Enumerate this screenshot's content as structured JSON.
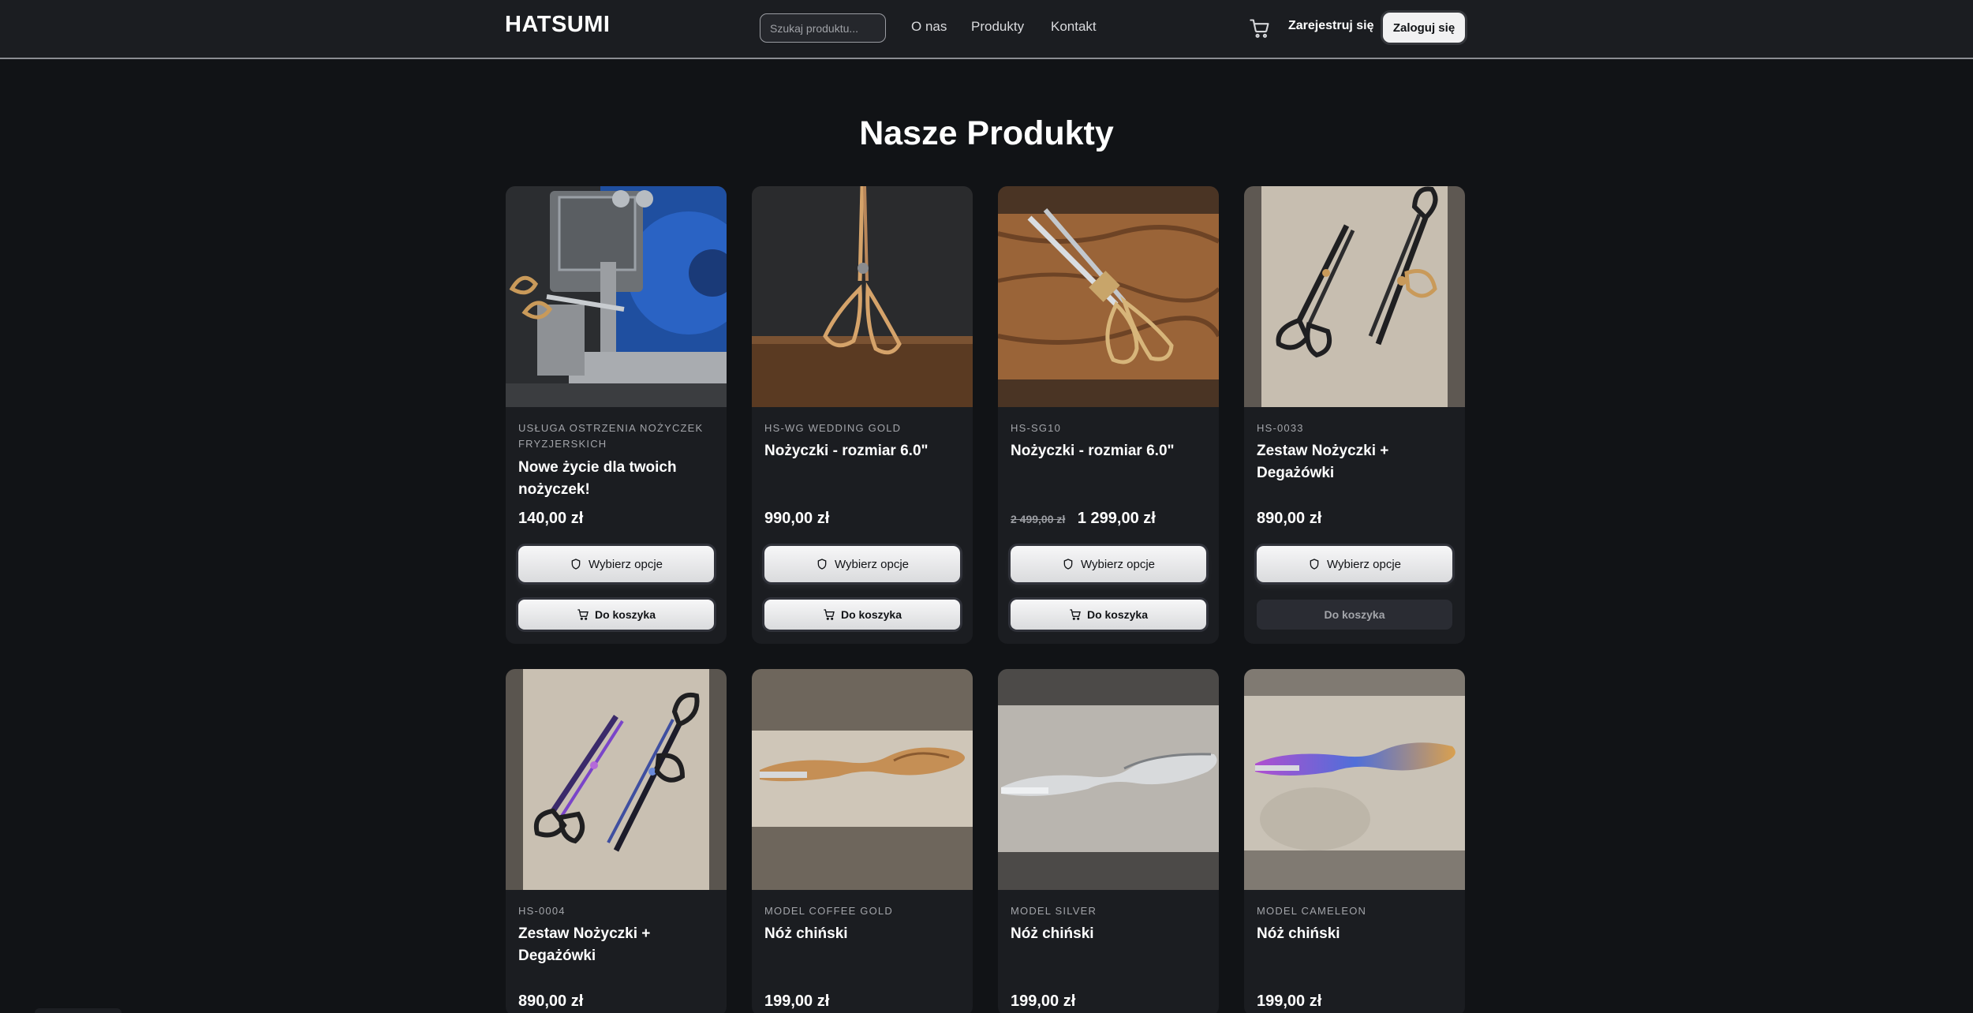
{
  "header": {
    "logo": "HATSUMI",
    "search_placeholder": "Szukaj produktu...",
    "nav": [
      "O nas",
      "Produkty",
      "Kontakt"
    ],
    "register_label": "Zarejestruj się",
    "login_label": "Zaloguj się",
    "cart_icon": "cart-icon"
  },
  "page_title": "Nasze Produkty",
  "colors": {
    "background": "#111316",
    "card": "#1b1d21",
    "button_light": "#f1f1f2"
  },
  "products": [
    {
      "sku": "USŁUGA OSTRZENIA NOŻYCZEK FRYZJERSKICH",
      "name": "Nowe życie dla twoich nożyczek!",
      "price": "140,00 zł",
      "old_price": "",
      "options_label": "Wybierz opcje",
      "cart_label": "Do koszyka"
    },
    {
      "sku": "HS-WG WEDDING GOLD",
      "name": "Nożyczki - rozmiar 6.0\"",
      "price": "990,00 zł",
      "old_price": "",
      "options_label": "Wybierz opcje",
      "cart_label": "Do koszyka"
    },
    {
      "sku": "HS-SG10",
      "name": "Nożyczki - rozmiar 6.0\"",
      "price": "1 299,00 zł",
      "old_price": "2 499,00 zł",
      "options_label": "Wybierz opcje",
      "cart_label": "Do koszyka"
    },
    {
      "sku": "HS-0033",
      "name": "Zestaw Nożyczki + Degażówki",
      "price": "890,00 zł",
      "old_price": "",
      "options_label": "Wybierz opcje",
      "cart_label": "Do koszyka"
    },
    {
      "sku": "HS-0004",
      "name": "Zestaw Nożyczki + Degażówki",
      "price": "890,00 zł",
      "old_price": ""
    },
    {
      "sku": "MODEL COFFEE GOLD",
      "name": "Nóż chiński",
      "price": "199,00 zł",
      "old_price": ""
    },
    {
      "sku": "MODEL SILVER",
      "name": "Nóż chiński",
      "price": "199,00 zł",
      "old_price": ""
    },
    {
      "sku": "MODEL CAMELEON",
      "name": "Nóż chiński",
      "price": "199,00 zł",
      "old_price": ""
    }
  ]
}
